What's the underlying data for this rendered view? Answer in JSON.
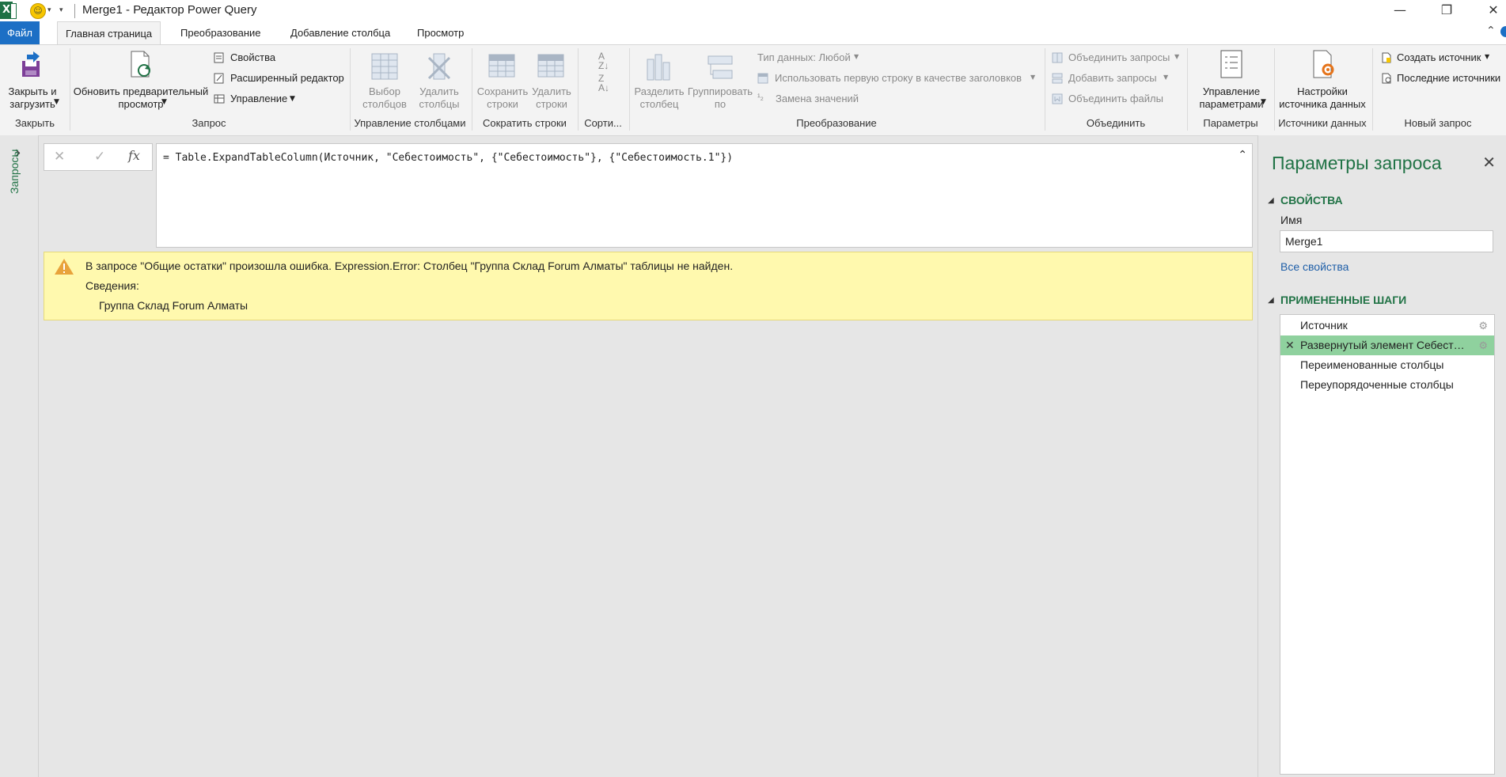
{
  "window": {
    "title": "Merge1 - Редактор Power Query",
    "excel_icon": "excel-icon",
    "smiley_icon": "smiley-feedback-icon",
    "minimize_glyph": "—",
    "restore_glyph": "❐",
    "close_glyph": "✕"
  },
  "tabs": [
    {
      "label": "Файл"
    },
    {
      "label": "Главная страница"
    },
    {
      "label": "Преобразование"
    },
    {
      "label": "Добавление столбца"
    },
    {
      "label": "Просмотр"
    }
  ],
  "ribbon": {
    "close_group": {
      "button": "Закрыть и\nзагрузить",
      "label": "Закрыть"
    },
    "query_group": {
      "refresh": "Обновить предварительный\nпросмотр",
      "properties": "Свойства",
      "advanced_editor": "Расширенный редактор",
      "manage": "Управление",
      "label": "Запрос"
    },
    "columns_group": {
      "choose": "Выбор\nстолбцов",
      "remove": "Удалить\nстолбцы",
      "label": "Управление столбцами"
    },
    "rows_group": {
      "keep": "Сохранить\nстроки",
      "remove": "Удалить\nстроки",
      "label": "Сократить строки"
    },
    "sort_group": {
      "label": "Сорти..."
    },
    "transform_group": {
      "split": "Разделить\nстолбец",
      "group_by": "Группировать\nпо",
      "data_type": "Тип данных: Любой",
      "first_row_headers": "Использовать первую строку в качестве заголовков",
      "replace_values": "Замена значений",
      "label": "Преобразование"
    },
    "combine_group": {
      "merge": "Объединить запросы",
      "append": "Добавить запросы",
      "combine_files": "Объединить файлы",
      "label": "Объединить"
    },
    "params_group": {
      "manage": "Управление\nпараметрами",
      "label": "Параметры"
    },
    "sources_group": {
      "settings": "Настройки\nисточника данных",
      "label": "Источники данных"
    },
    "new_query_group": {
      "new_source": "Создать источник",
      "recent_sources": "Последние источники",
      "label": "Новый запрос"
    }
  },
  "left_pane": {
    "label": "Запросы",
    "expand_glyph": "›"
  },
  "formula_bar": {
    "cancel_glyph": "✕",
    "confirm_glyph": "✓",
    "fx_label": "fx",
    "formula": "= Table.ExpandTableColumn(Источник, \"Себестоимость\", {\"Себестоимость\"}, {\"Себестоимость.1\"})",
    "collapse_glyph": "⌃"
  },
  "error": {
    "message": "В запросе \"Общие остатки\" произошла ошибка. Expression.Error: Столбец \"Группа Склад Forum Алматы\" таблицы не найден.",
    "details_label": "Сведения:",
    "details_value": "Группа Склад Forum Алматы"
  },
  "query_settings": {
    "title": "Параметры запроса",
    "properties_header": "СВОЙСТВА",
    "name_label": "Имя",
    "name_value": "Merge1",
    "all_properties": "Все свойства",
    "applied_steps_header": "ПРИМЕНЕННЫЕ ШАГИ",
    "steps": [
      {
        "label": "Источник",
        "gear": true,
        "selected": false
      },
      {
        "label": "Развернутый элемент Себестоимость",
        "gear": true,
        "selected": true
      },
      {
        "label": "Переименованные столбцы",
        "gear": false,
        "selected": false
      },
      {
        "label": "Переупорядоченные столбцы",
        "gear": false,
        "selected": false
      }
    ]
  },
  "colors": {
    "accent_green": "#217346",
    "file_tab_blue": "#1c6fc5",
    "error_yellow": "#fff9ae",
    "selected_step": "#8fd19e"
  }
}
